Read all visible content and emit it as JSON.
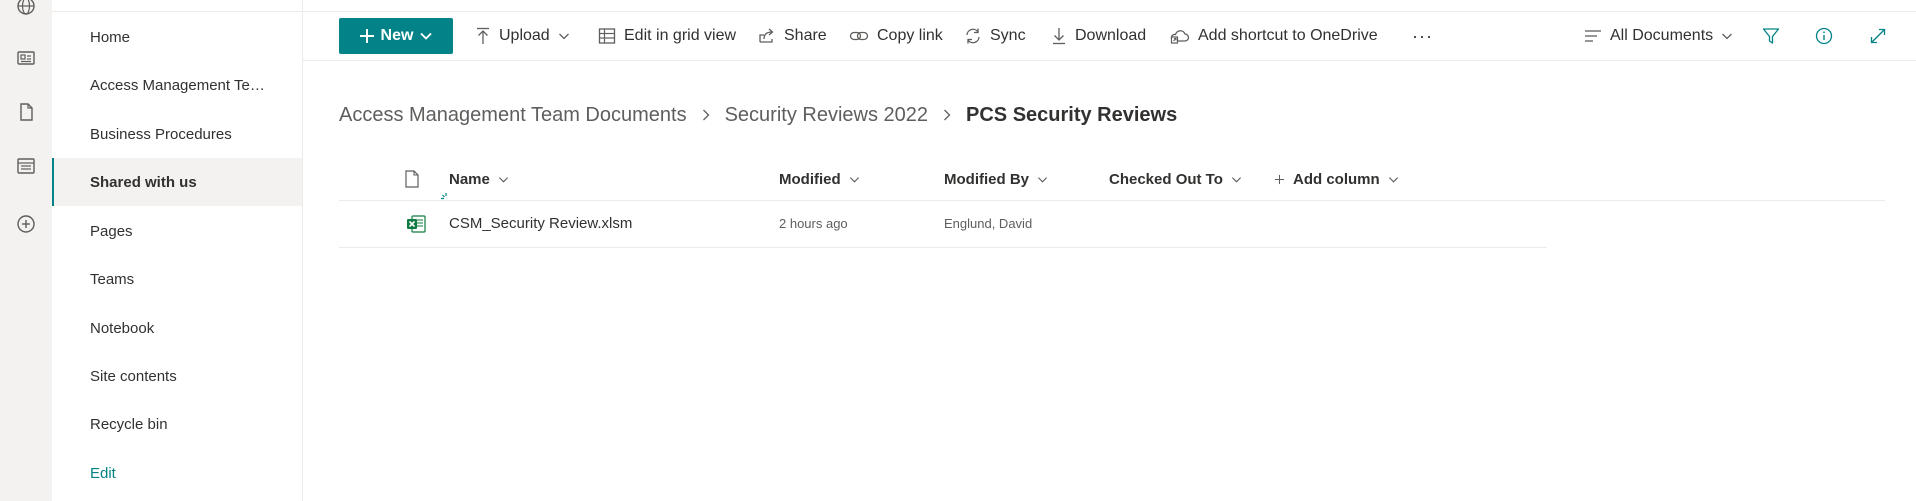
{
  "colors": {
    "accent": "#038387",
    "excel": "#107c41",
    "text": "#323130",
    "muted": "#605e5c"
  },
  "left_nav": {
    "items": [
      {
        "label": "Home"
      },
      {
        "label": "Access Management Tea..."
      },
      {
        "label": "Business Procedures"
      },
      {
        "label": "Shared with us",
        "selected": true
      },
      {
        "label": "Pages"
      },
      {
        "label": "Teams"
      },
      {
        "label": "Notebook"
      },
      {
        "label": "Site contents"
      },
      {
        "label": "Recycle bin"
      }
    ],
    "edit_label": "Edit"
  },
  "rail_icons": [
    "globe-icon",
    "news-icon",
    "document-icon",
    "list-icon",
    "add-circle-icon"
  ],
  "command_bar": {
    "new_label": "New",
    "upload_label": "Upload",
    "edit_grid_label": "Edit in grid view",
    "share_label": "Share",
    "copy_link_label": "Copy link",
    "sync_label": "Sync",
    "download_label": "Download",
    "add_shortcut_label": "Add shortcut to OneDrive",
    "more_label": "···",
    "view_label": "All Documents"
  },
  "breadcrumb": {
    "items": [
      "Access Management Team Documents",
      "Security Reviews 2022"
    ],
    "current": "PCS Security Reviews"
  },
  "list": {
    "columns": {
      "name": "Name",
      "modified": "Modified",
      "modified_by": "Modified By",
      "checked_out_to": "Checked Out To",
      "add_column": "Add column"
    },
    "rows": [
      {
        "name": "CSM_Security Review.xlsm",
        "modified": "2 hours ago",
        "modified_by": "Englund, David",
        "checked_out_to": "",
        "file_type": "excel-file-icon",
        "new_indicator": true
      }
    ]
  }
}
